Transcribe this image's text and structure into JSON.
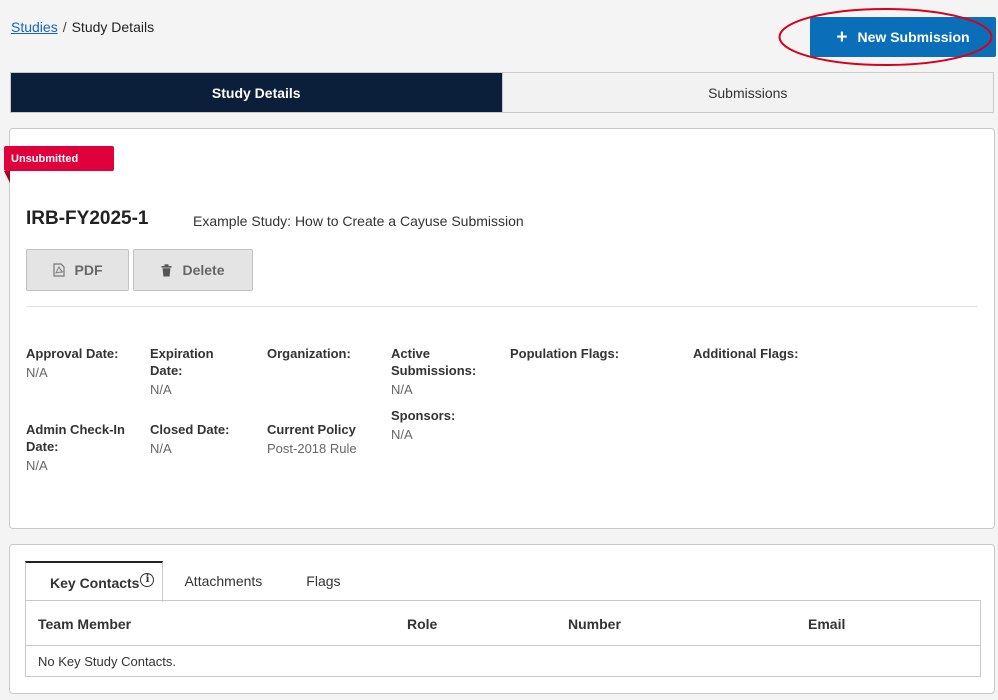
{
  "breadcrumb": {
    "root": "Studies",
    "separator": "/",
    "current": "Study Details"
  },
  "actions": {
    "new_submission": "New Submission",
    "new_submission_icon": "plus-icon"
  },
  "top_tabs": [
    {
      "label": "Study Details",
      "active": true
    },
    {
      "label": "Submissions",
      "active": false
    }
  ],
  "study": {
    "status": "Unsubmitted",
    "status_color": "#e0003c",
    "id": "IRB-FY2025-1",
    "title": "Example Study: How to Create a Cayuse Submission",
    "buttons": {
      "pdf": "PDF",
      "delete": "Delete"
    },
    "fields": {
      "approval_date": {
        "label": "Approval Date:",
        "value": "N/A"
      },
      "expiration_date": {
        "label": "Expiration Date:",
        "value": "N/A"
      },
      "organization": {
        "label": "Organization:",
        "value": ""
      },
      "active_submissions": {
        "label": "Active Submissions:",
        "value": "N/A"
      },
      "sponsors": {
        "label": "Sponsors:",
        "value": "N/A"
      },
      "population_flags": {
        "label": "Population Flags:",
        "value": ""
      },
      "additional_flags": {
        "label": "Additional Flags:",
        "value": ""
      },
      "admin_checkin_date": {
        "label": "Admin Check-In Date:",
        "value": "N/A"
      },
      "closed_date": {
        "label": "Closed Date:",
        "value": "N/A"
      },
      "current_policy": {
        "label": "Current Policy",
        "value": "Post-2018 Rule"
      }
    }
  },
  "contacts": {
    "tabs": [
      {
        "label": "Key Contacts",
        "active": true
      },
      {
        "label": "Attachments",
        "active": false
      },
      {
        "label": "Flags",
        "active": false
      }
    ],
    "columns": [
      "Team Member",
      "Role",
      "Number",
      "Email"
    ],
    "empty_message": "No Key Study Contacts."
  },
  "colors": {
    "accent": "#0a6fb8",
    "nav_active": "#0b1f3a",
    "highlight": "#d9001b"
  }
}
